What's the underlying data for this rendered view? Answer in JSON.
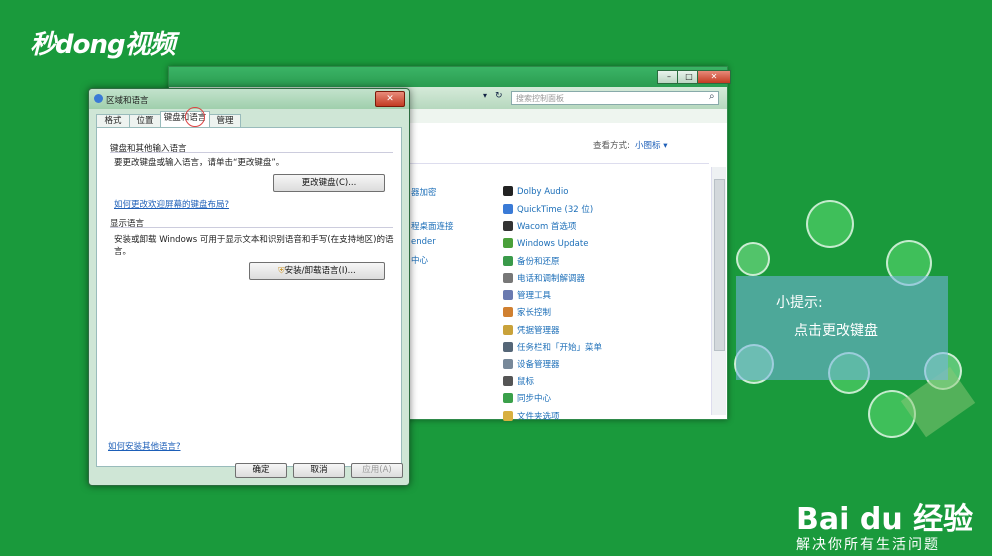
{
  "brand": {
    "text": "秒dong视频"
  },
  "control_panel": {
    "search_placeholder": "搜索控制面板",
    "view_by_label": "查看方式:",
    "view_by_value": "小图标 ▾",
    "left_fragments": [
      "器加密",
      "程桌面连接",
      "ender",
      "中心"
    ],
    "items": [
      {
        "label": "Dolby Audio",
        "color": "#222222"
      },
      {
        "label": "QuickTime (32 位)",
        "color": "#3a7ad6"
      },
      {
        "label": "Wacom 首选项",
        "color": "#333333"
      },
      {
        "label": "Windows Update",
        "color": "#4aa03a"
      },
      {
        "label": "备份和还原",
        "color": "#3a9a4a"
      },
      {
        "label": "电话和调制解调器",
        "color": "#777777"
      },
      {
        "label": "管理工具",
        "color": "#6a7ab0"
      },
      {
        "label": "家长控制",
        "color": "#d08030"
      },
      {
        "label": "凭据管理器",
        "color": "#c9a23a"
      },
      {
        "label": "任务栏和「开始」菜单",
        "color": "#556677"
      },
      {
        "label": "设备管理器",
        "color": "#778899"
      },
      {
        "label": "鼠标",
        "color": "#555555"
      },
      {
        "label": "同步中心",
        "color": "#3aa04a"
      },
      {
        "label": "文件夹选项",
        "color": "#d8b040"
      }
    ]
  },
  "dialog": {
    "title": "区域和语言",
    "tabs": [
      "格式",
      "位置",
      "键盘和语言",
      "管理"
    ],
    "keyboard_group": {
      "title": "键盘和其他输入语言",
      "description": "要更改键盘或输入语言，请单击“更改键盘”。",
      "change_button": "更改键盘(C)...",
      "link": "如何更改欢迎屏幕的键盘布局?"
    },
    "display_group": {
      "title": "显示语言",
      "description_line1": "安装或卸载 Windows 可用于显示文本和识别语音和手写(在支持地区)的语",
      "description_line2": "言。",
      "install_button": "安装/卸载语言(I)..."
    },
    "bottom_link": "如何安装其他语言?",
    "ok": "确定",
    "cancel": "取消",
    "apply": "应用(A)"
  },
  "tip": {
    "title": "小提示:",
    "text": "点击更改键盘"
  },
  "watermark": {
    "logo": "Bai du 经验",
    "slogan": "解决你所有生活问题"
  }
}
